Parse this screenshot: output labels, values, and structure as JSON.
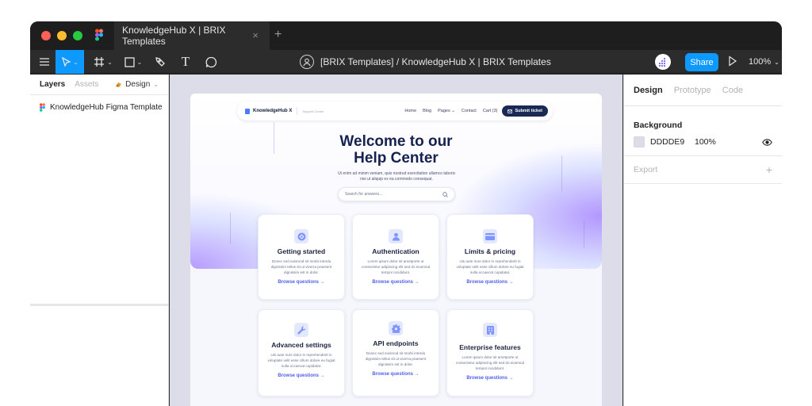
{
  "titlebar": {
    "tab_title": "KnowledgeHub X | BRIX Templates",
    "tab_close": "×",
    "tab_add": "+"
  },
  "toolbar": {
    "file_title": "[BRIX Templates] / KnowledgeHub X | BRIX Templates",
    "share_label": "Share",
    "zoom_level": "100%",
    "caret": "⌄",
    "text_tool": "T"
  },
  "left_panel": {
    "tabs": [
      {
        "label": "Layers",
        "active": true
      },
      {
        "label": "Assets",
        "active": false
      }
    ],
    "page_selector": "Design",
    "layers": [
      {
        "label": "KnowledgeHub Figma Template"
      }
    ]
  },
  "canvas": {
    "background": "#DDDDE9",
    "nav": {
      "logo": "KnowledgeHub X",
      "sub": "Support Center",
      "links": [
        "Home",
        "Blog",
        "Pages",
        "Contact",
        "Cart (3)"
      ],
      "pages_caret": "⌄",
      "submit": "Submit ticket"
    },
    "hero": {
      "title_line1": "Welcome to our",
      "title_line2": "Help Center",
      "subtitle_line1": "Ut enim ad minim veniam, quis nostrud exercitation ullamco laboris",
      "subtitle_line2": "nisi ut aliquip ex ea commodo consequat.",
      "search_placeholder": "Search for answers..."
    },
    "cards": [
      {
        "icon": "compass-icon",
        "title": "Getting started",
        "desc": "Donec sed euismod sit morbi interdu dignissim tellus sit ut viverra praesent dignissim est in dolor.",
        "link": "Browse questions →"
      },
      {
        "icon": "user-icon",
        "title": "Authentication",
        "desc": "Lorem ipsum dolor sit ametporte ut consectetur adipiscing elit sed do eiusmod tempor incididunt.",
        "link": "Browse questions →"
      },
      {
        "icon": "card-icon",
        "title": "Limits & pricing",
        "desc": "Uis aute irure dolor in reprehenderit in voluptate velit esse cillum dolore eu fugiat nulla occaecat cupidatat.",
        "link": "Browse questions →"
      },
      {
        "icon": "wrench-icon",
        "title": "Advanced settings",
        "desc": "Uis aute irure dolor in reprehenderit in voluptate velit esse cillum dolore eu fugiat nulla occaecat cupidatat.",
        "link": "Browse questions →"
      },
      {
        "icon": "gear-icon",
        "title": "API endpoints",
        "desc": "Donec sed euismod sit morbi interdu dignissim tellus sit ut viverra praesent dignissim est in dolor.",
        "link": "Browse questions →"
      },
      {
        "icon": "building-icon",
        "title": "Enterprise features",
        "desc": "Lorem ipsum dolor sit ametporte ut consectetur adipiscing elit sed do eiusmod tempor incididunt.",
        "link": "Browse questions →"
      }
    ]
  },
  "right_panel": {
    "tabs": [
      {
        "label": "Design",
        "active": true
      },
      {
        "label": "Prototype",
        "active": false
      },
      {
        "label": "Code",
        "active": false
      }
    ],
    "background": {
      "title": "Background",
      "hex": "DDDDE9",
      "opacity": "100%",
      "swatch_color": "#DDDDE9"
    },
    "export": {
      "title": "Export",
      "add": "+"
    }
  },
  "colors": {
    "accent": "#0D99FF",
    "navy": "#1B2A55",
    "link": "#4F5FF0"
  }
}
